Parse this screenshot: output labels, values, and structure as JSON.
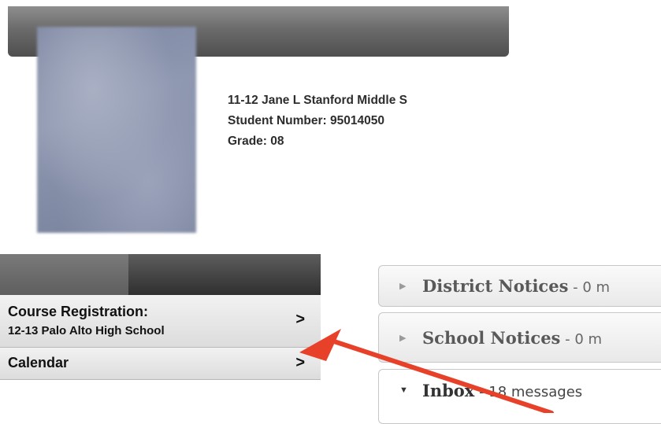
{
  "student": {
    "school": "11-12 Jane L Stanford Middle S",
    "student_number": "Student Number: 95014050",
    "grade": "Grade: 08"
  },
  "nav": {
    "items": [
      {
        "label": "Course Registration:",
        "sublabel": "12-13 Palo Alto High School",
        "chevron": ">"
      },
      {
        "label": "Calendar",
        "chevron": ">"
      }
    ]
  },
  "panels": {
    "district": {
      "title": "District Notices",
      "count": " - 0 m"
    },
    "school": {
      "title": "School Notices",
      "count": " - 0 m"
    },
    "inbox": {
      "title": "Inbox",
      "count": " - 18 messages"
    }
  },
  "colors": {
    "annotation_arrow": "#e8412a",
    "header_bar": "#6b6b6b",
    "nav_header": "#3a3a3a"
  },
  "icons": {
    "collapsed": "triangle-right-icon",
    "expanded": "triangle-down-icon",
    "chevron": "chevron-right-icon"
  }
}
